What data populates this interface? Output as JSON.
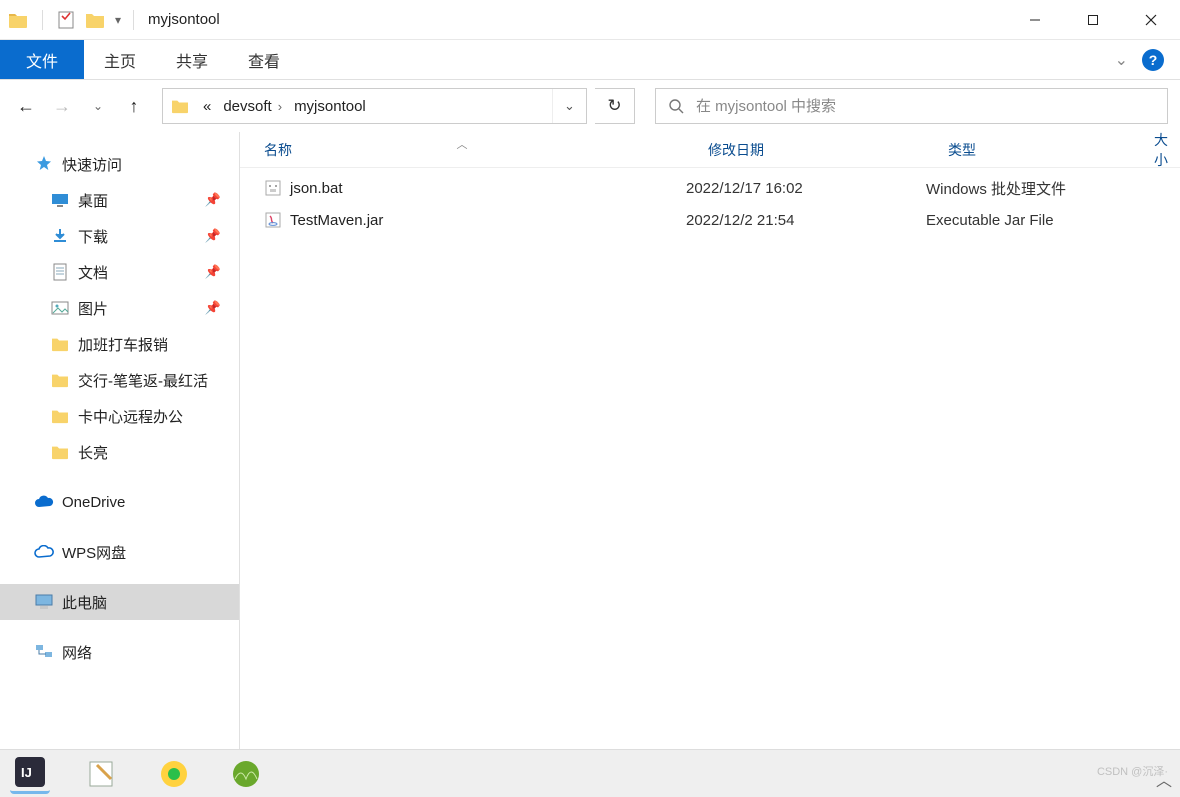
{
  "window": {
    "title": "myjsontool"
  },
  "ribbon": {
    "file": "文件",
    "tabs": [
      "主页",
      "共享",
      "查看"
    ]
  },
  "breadcrumb": {
    "prefix": "«",
    "items": [
      "devsoft",
      "myjsontool"
    ]
  },
  "search": {
    "placeholder": "在 myjsontool 中搜索"
  },
  "columns": {
    "name": "名称",
    "date": "修改日期",
    "type": "类型",
    "size": "大小"
  },
  "sidebar": {
    "quick": "快速访问",
    "quick_items": [
      {
        "label": "桌面",
        "icon": "desktop",
        "pinned": true
      },
      {
        "label": "下载",
        "icon": "download",
        "pinned": true
      },
      {
        "label": "文档",
        "icon": "document",
        "pinned": true
      },
      {
        "label": "图片",
        "icon": "picture",
        "pinned": true
      },
      {
        "label": "加班打车报销",
        "icon": "folder",
        "pinned": false
      },
      {
        "label": "交行-笔笔返-最红活",
        "icon": "folder",
        "pinned": false
      },
      {
        "label": "卡中心远程办公",
        "icon": "folder",
        "pinned": false
      },
      {
        "label": "长亮",
        "icon": "folder",
        "pinned": false
      }
    ],
    "onedrive": "OneDrive",
    "wps": "WPS网盘",
    "thispc": "此电脑",
    "network": "网络"
  },
  "files": [
    {
      "name": "json.bat",
      "date": "2022/12/17 16:02",
      "type": "Windows 批处理文件",
      "icon": "bat"
    },
    {
      "name": "TestMaven.jar",
      "date": "2022/12/2 21:54",
      "type": "Executable Jar File",
      "icon": "jar"
    }
  ],
  "watermark": "CSDN @沉泽·"
}
